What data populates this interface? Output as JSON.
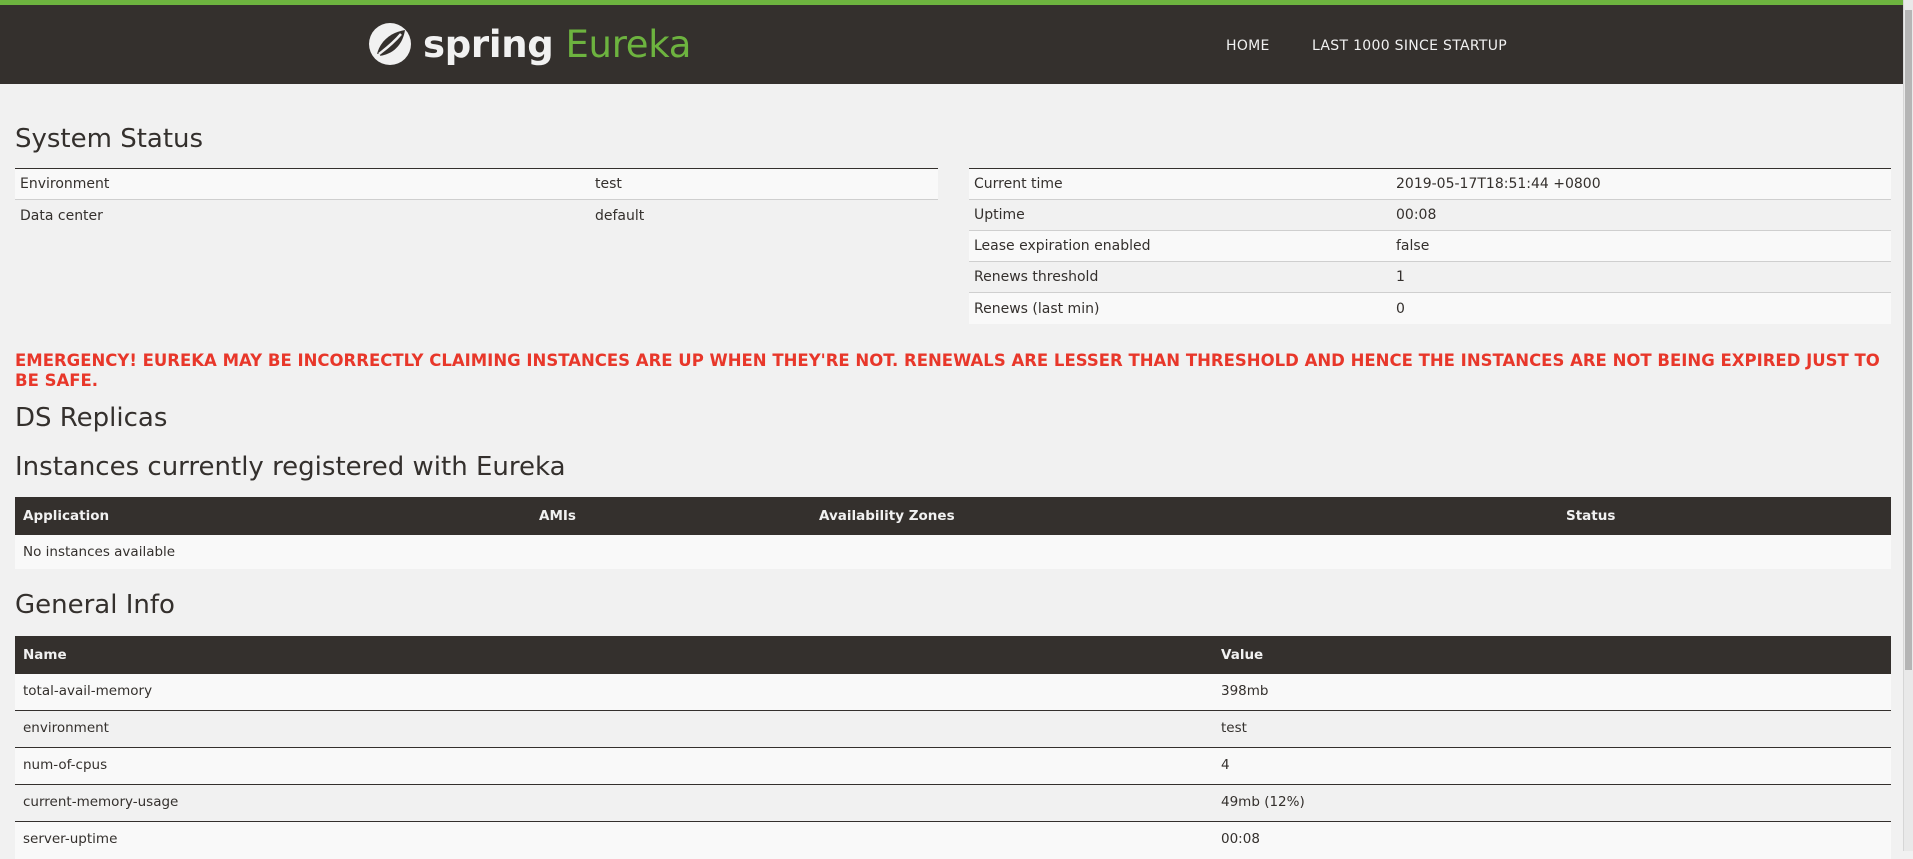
{
  "nav": {
    "brand_spring": "spring",
    "brand_eureka": "Eureka",
    "home": "HOME",
    "last1000": "LAST 1000 SINCE STARTUP"
  },
  "system_status": {
    "title": "System Status",
    "left": [
      {
        "key": "Environment",
        "value": "test"
      },
      {
        "key": "Data center",
        "value": "default"
      }
    ],
    "right": [
      {
        "key": "Current time",
        "value": "2019-05-17T18:51:44 +0800"
      },
      {
        "key": "Uptime",
        "value": "00:08"
      },
      {
        "key": "Lease expiration enabled",
        "value": "false"
      },
      {
        "key": "Renews threshold",
        "value": "1"
      },
      {
        "key": "Renews (last min)",
        "value": "0"
      }
    ]
  },
  "emergency": "EMERGENCY! EUREKA MAY BE INCORRECTLY CLAIMING INSTANCES ARE UP WHEN THEY'RE NOT. RENEWALS ARE LESSER THAN THRESHOLD AND HENCE THE INSTANCES ARE NOT BEING EXPIRED JUST TO BE SAFE.",
  "ds_replicas": {
    "title": "DS Replicas"
  },
  "instances": {
    "title": "Instances currently registered with Eureka",
    "headers": [
      "Application",
      "AMIs",
      "Availability Zones",
      "Status"
    ],
    "empty": "No instances available"
  },
  "general_info": {
    "title": "General Info",
    "headers": [
      "Name",
      "Value"
    ],
    "rows": [
      {
        "name": "total-avail-memory",
        "value": "398mb"
      },
      {
        "name": "environment",
        "value": "test"
      },
      {
        "name": "num-of-cpus",
        "value": "4"
      },
      {
        "name": "current-memory-usage",
        "value": "49mb (12%)"
      },
      {
        "name": "server-uptime",
        "value": "00:08"
      }
    ]
  },
  "colors": {
    "navbar": "#34302d",
    "accent": "#6db33f",
    "emergency": "#e8372a",
    "background": "#f1f1f1"
  }
}
